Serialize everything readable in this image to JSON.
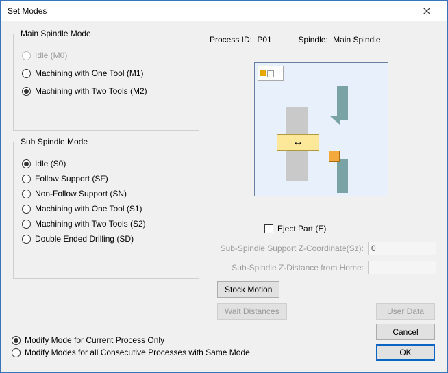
{
  "window": {
    "title": "Set Modes"
  },
  "header": {
    "process_label": "Process ID:",
    "process_value": "P01",
    "spindle_label": "Spindle:",
    "spindle_value": "Main Spindle"
  },
  "main_group": {
    "legend": "Main Spindle Mode",
    "options": {
      "idle": "Idle (M0)",
      "m1": "Machining with One Tool (M1)",
      "m2": "Machining with Two Tools (M2)"
    }
  },
  "sub_group": {
    "legend": "Sub Spindle Mode",
    "options": {
      "s0": "Idle (S0)",
      "sf": "Follow Support (SF)",
      "sn": "Non-Follow Support (SN)",
      "s1": "Machining with One Tool (S1)",
      "s2": "Machining with Two Tools (S2)",
      "sd": "Double Ended Drilling (SD)"
    }
  },
  "eject": {
    "label": "Eject Part (E)"
  },
  "fields": {
    "sz_label": "Sub-Spindle Support Z-Coordinate(Sz):",
    "sz_value": "0",
    "home_label": "Sub-Spindle Z-Distance from Home:",
    "home_value": ""
  },
  "buttons": {
    "stock_motion": "Stock Motion",
    "wait_distances": "Wait Distances",
    "user_data": "User Data",
    "cancel": "Cancel",
    "ok": "OK"
  },
  "scope": {
    "current": "Modify Mode for Current Process Only",
    "all": "Modify Modes for all Consecutive Processes with Same Mode"
  }
}
